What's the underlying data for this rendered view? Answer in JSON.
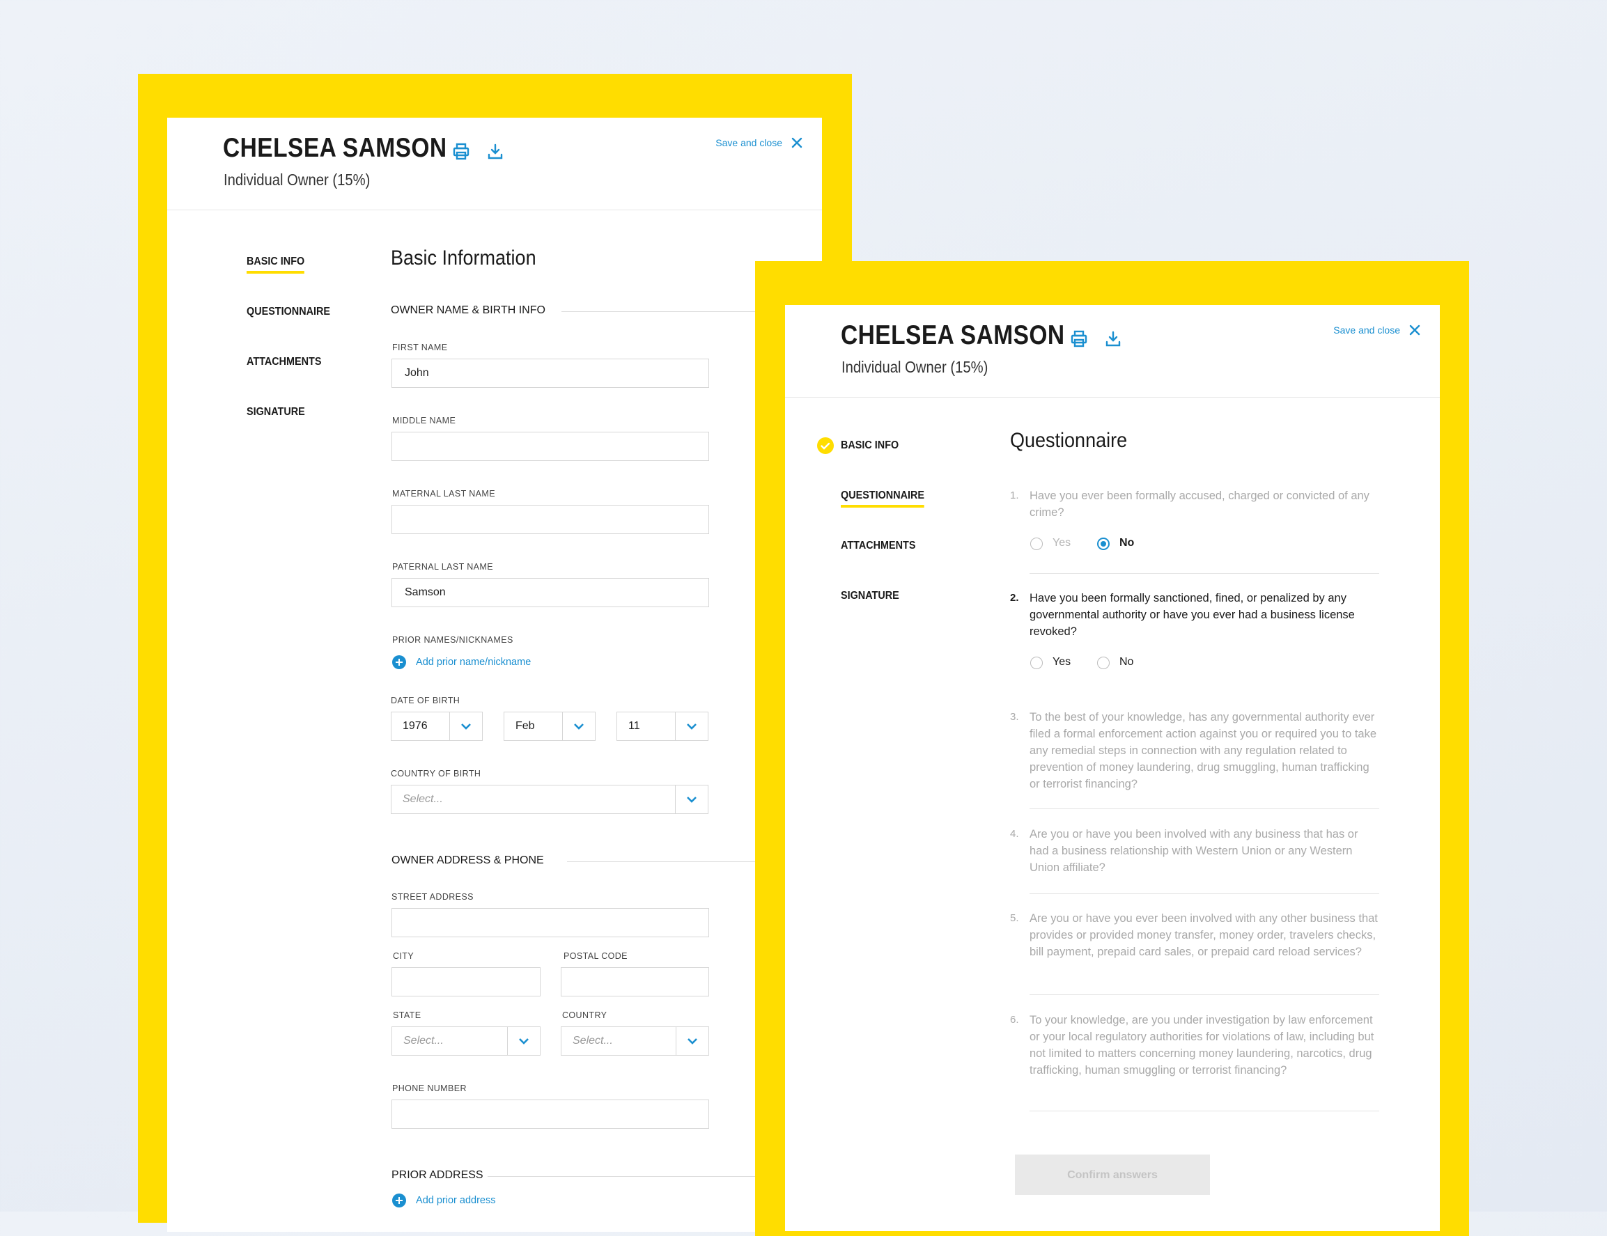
{
  "colors": {
    "brand_yellow": "#FFDD00",
    "link_blue": "#1a8fd0",
    "background": "#e9eef5"
  },
  "header": {
    "name": "CHELSEA SAMSON",
    "role": "Individual Owner (15%)",
    "save_label": "Save and close",
    "icons": [
      "printer-icon",
      "download-icon",
      "close-icon"
    ]
  },
  "nav": {
    "basic_info": "BASIC INFO",
    "questionnaire": "QUESTIONNAIRE",
    "attachments": "ATTACHMENTS",
    "signature": "SIGNATURE"
  },
  "basic_form": {
    "title": "Basic Information",
    "section_name": "OWNER NAME & BIRTH INFO",
    "first_name": {
      "label": "FIRST NAME",
      "value": "John"
    },
    "middle_name": {
      "label": "MIDDLE NAME",
      "value": ""
    },
    "maternal_last_name": {
      "label": "MATERNAL LAST NAME",
      "value": ""
    },
    "paternal_last_name": {
      "label": "PATERNAL LAST NAME",
      "value": "Samson"
    },
    "prior_names": {
      "label": "PRIOR NAMES/NICKNAMES",
      "add_link": "Add prior name/nickname"
    },
    "dob": {
      "label": "DATE OF BIRTH",
      "year": "1976",
      "month": "Feb",
      "day": "11"
    },
    "country_of_birth": {
      "label": "COUNTRY OF BIRTH",
      "placeholder": "Select..."
    },
    "section_address": "OWNER ADDRESS & PHONE",
    "street": {
      "label": "STREET ADDRESS",
      "value": ""
    },
    "city": {
      "label": "CITY",
      "value": ""
    },
    "postal_code": {
      "label": "POSTAL CODE",
      "value": ""
    },
    "state": {
      "label": "STATE",
      "placeholder": "Select..."
    },
    "country": {
      "label": "COUNTRY",
      "placeholder": "Select..."
    },
    "phone": {
      "label": "PHONE NUMBER",
      "value": ""
    },
    "section_prior_address": "PRIOR ADDRESS",
    "add_prior_address": "Add prior address"
  },
  "questionnaire": {
    "title": "Questionnaire",
    "yes_label": "Yes",
    "no_label": "No",
    "questions": [
      {
        "num": "1.",
        "text": "Have you ever been formally accused, charged or convicted of any crime?",
        "answer": "No"
      },
      {
        "num": "2.",
        "text": "Have you been formally sanctioned, fined, or penalized by any governmental authority or have you ever had a business license revoked?",
        "answer": ""
      },
      {
        "num": "3.",
        "text": "To the best of your knowledge, has any governmental authority ever filed a formal enforcement action against you or required you to take any remedial steps in connection with any regulation related to prevention of money laundering, drug smuggling, human trafficking or terrorist financing?"
      },
      {
        "num": "4.",
        "text": "Are you or have you been involved with any business that has or had a business relationship with Western Union or any Western Union affiliate?"
      },
      {
        "num": "5.",
        "text": "Are you or have you ever been involved with any other business that provides or provided money transfer, money order, travelers checks, bill payment, prepaid card sales, or prepaid card reload services?"
      },
      {
        "num": "6.",
        "text": "To your knowledge, are you under investigation by law enforcement or your local regulatory authorities for violations of law, including but not limited to matters concerning money laundering, narcotics, drug trafficking, human smuggling or terrorist financing?"
      }
    ],
    "confirm_label": "Confirm answers"
  }
}
